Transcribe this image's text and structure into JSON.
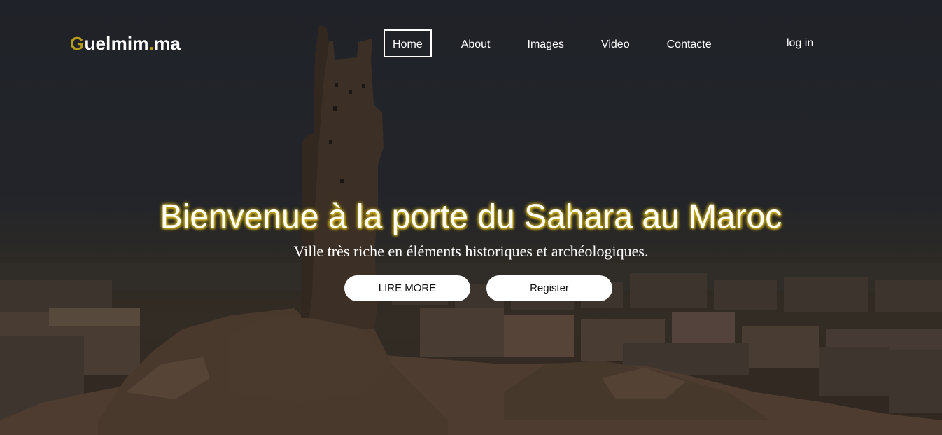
{
  "brand": {
    "first_letter": "G",
    "name": "uelmim",
    "dot": ".",
    "tld": "ma"
  },
  "nav": {
    "home": "Home",
    "about": "About",
    "images": "Images",
    "video": "Video",
    "contact": "Contacte",
    "login": "log in"
  },
  "hero": {
    "title": "Bienvenue à la porte du Sahara au Maroc",
    "subtitle": "Ville très riche en éléments historiques et archéologiques.",
    "primary_button": "LIRE MORE",
    "secondary_button": "Register"
  },
  "colors": {
    "accent": "#b59b1a",
    "title_glow": "#e0c320",
    "button_bg": "#ffffff"
  }
}
